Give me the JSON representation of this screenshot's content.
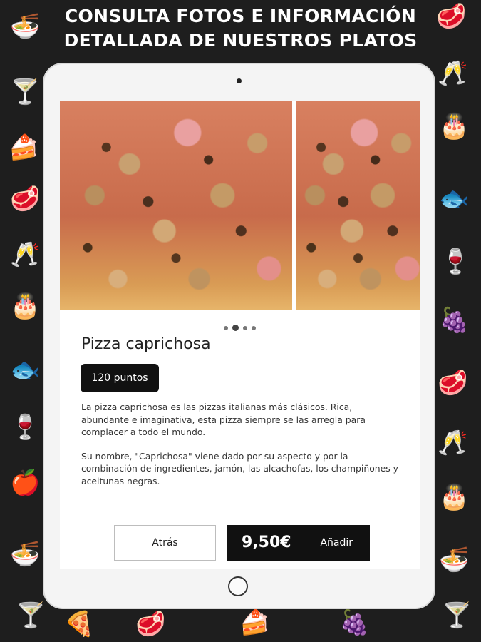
{
  "banner": {
    "line1": "CONSULTA FOTOS E INFORMACIÓN",
    "line2": "DETALLADA DE NUESTROS PLATOS"
  },
  "background_icons": [
    "noodle-bowl-icon",
    "steak-icon",
    "cocktail-icon",
    "wine-glasses-icon",
    "cake-icon",
    "birthday-cake-icon",
    "fish-icon",
    "wine-bottle-icon",
    "fruit-icon",
    "pizza-icon"
  ],
  "gallery": {
    "slides": [
      "pizza-photo",
      "pizza-photo"
    ],
    "page_count": 4,
    "active_index": 1
  },
  "dish": {
    "name": "Pizza caprichosa",
    "points": "120 puntos",
    "description_1": "La pizza caprichosa es las pizzas italianas más clásicos. Rica, abundante e imaginativa, esta pizza siempre se las arregla para complacer a todo el mundo.",
    "description_2": "Su nombre, \"Caprichosa\" viene dado por su aspecto y por la combinación de ingredientes, jamón, las alcachofas, los champiñones y aceitunas negras."
  },
  "actions": {
    "back_label": "Atrás",
    "price": "9,50€",
    "add_label": "Añadir"
  },
  "colors": {
    "background": "#1e1e1e",
    "icon_gray": "#8e8e8e",
    "button_dark": "#111111"
  }
}
